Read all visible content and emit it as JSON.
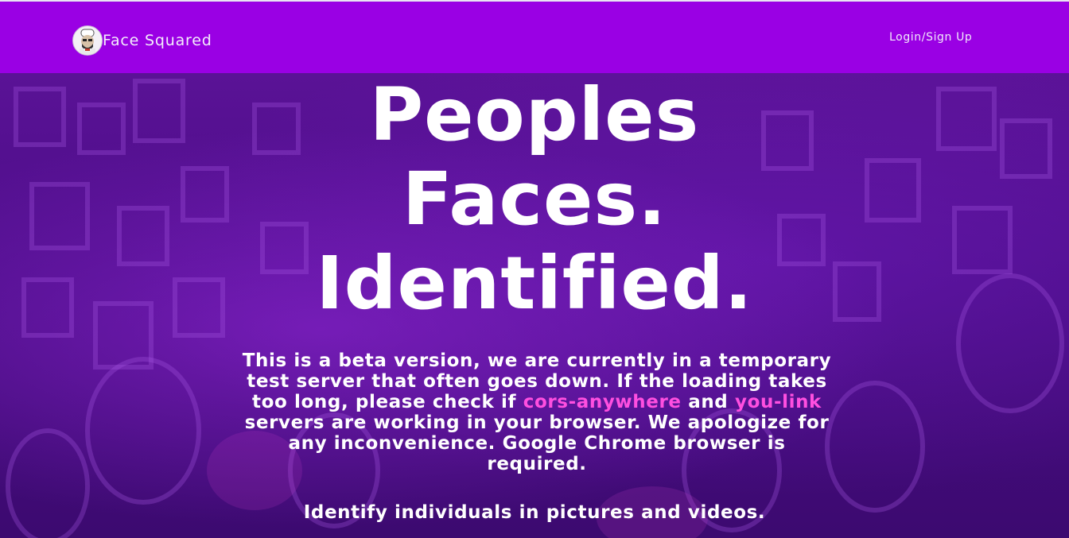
{
  "nav": {
    "brand": "Face Squared",
    "login_label": "Login/Sign Up"
  },
  "hero": {
    "headline_lines": [
      "Peoples",
      "Faces.",
      "Identified."
    ],
    "notice": {
      "before": "This is a beta version, we are currently in a temporary test server that often goes down. If the loading takes too long, please check if ",
      "link1": "cors-anywhere",
      "between": " and ",
      "link2": "you-link",
      "after": " servers are working in your browser. We apologize for any inconvenience. Google Chrome browser is required."
    },
    "tagline": "Identify individuals in pictures and videos."
  },
  "colors": {
    "navbar": "#9a00e4",
    "link": "#ff4fe0",
    "hero_bg": "#4a0d86"
  }
}
